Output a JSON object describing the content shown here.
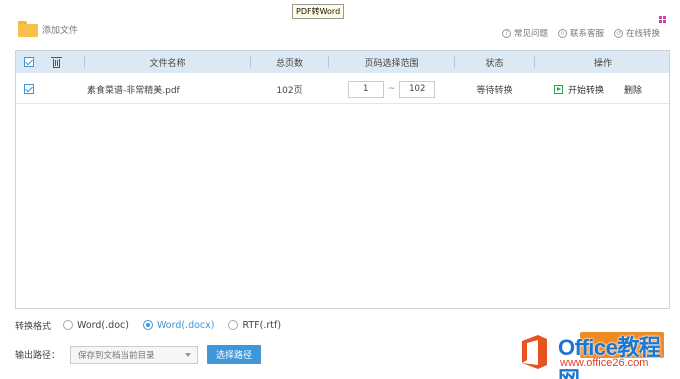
{
  "window": {
    "title": "PDF转Word"
  },
  "toolbar": {
    "add_file_label": "添加文件",
    "links": [
      {
        "label": "常见问题",
        "icon": "help-icon"
      },
      {
        "label": "联系客服",
        "icon": "headset-icon"
      },
      {
        "label": "在线转换",
        "icon": "online-convert-icon"
      }
    ]
  },
  "table": {
    "headers": {
      "filename": "文件名称",
      "total_pages": "总页数",
      "page_range": "页码选择范围",
      "status": "状态",
      "actions": "操作"
    },
    "rows": [
      {
        "checked": true,
        "filename": "素食菜谱-非常精美.pdf",
        "total_pages": "102页",
        "range_from": "1",
        "range_sep": "~",
        "range_to": "102",
        "status": "等待转换",
        "start_label": "开始转换",
        "delete_label": "删除"
      }
    ]
  },
  "format": {
    "label": "转换格式",
    "options": [
      {
        "label": "Word(.doc)",
        "selected": false
      },
      {
        "label": "Word(.docx)",
        "selected": true
      },
      {
        "label": "RTF(.rtf)",
        "selected": false
      }
    ]
  },
  "output": {
    "label": "输出路径：",
    "selected": "保存到文档当前目录",
    "choose_label": "选择路径"
  },
  "watermark": {
    "title": "Office教程网",
    "url": "www.office26.com"
  },
  "colors": {
    "accent": "#3f96d8",
    "header_bg": "#dce9f5",
    "start_green": "#2fa24a",
    "orange": "#f08a24",
    "folder": "#f7c04a"
  }
}
